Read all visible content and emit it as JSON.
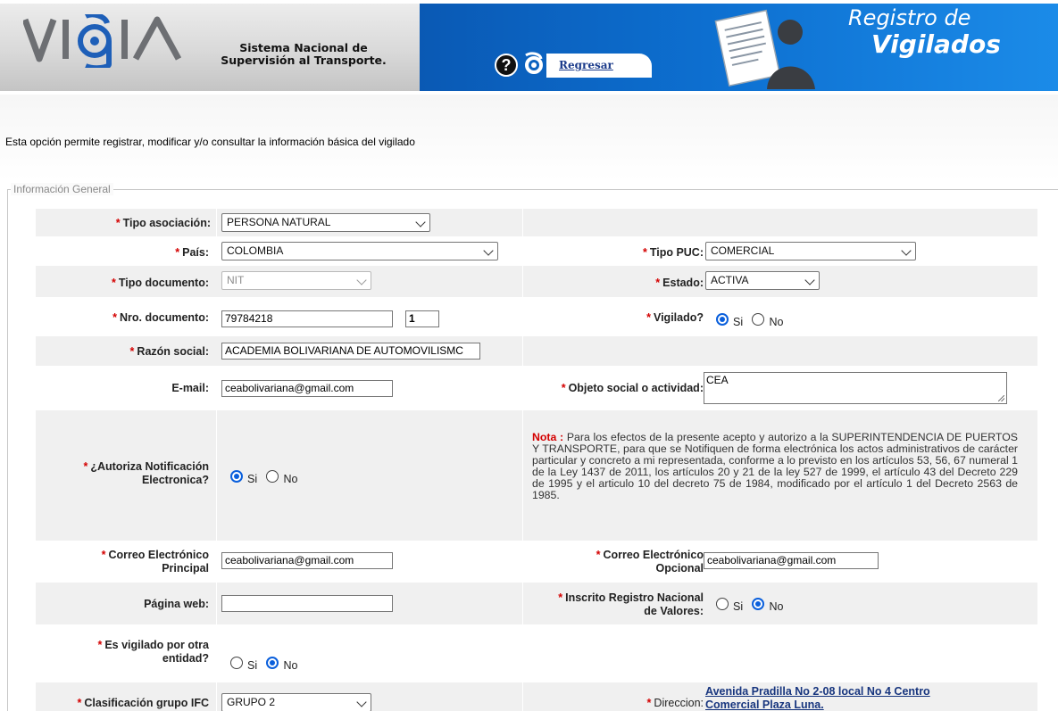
{
  "header": {
    "logo_text": "VIGIA",
    "system_title": "Sistema Nacional de Supervisión al Transporte.",
    "back_link": "Regresar",
    "module_title_line1": "Registro de",
    "module_title_line2": "Vigilados",
    "icons": [
      "help-icon",
      "vigia-mini-logo-icon",
      "document-user-icon"
    ]
  },
  "intro_text": "Esta opción permite registrar, modificar y/o consultar la información básica del vigilado",
  "section_title": "Información General",
  "colors": {
    "header_blue": "#0d6fd0",
    "required_red": "#d40000",
    "radio_selected": "#0a5fdc",
    "row_grey": "#f0f0f0",
    "link_navy": "#17357e"
  },
  "required_mark": "*",
  "form": {
    "tipo_asociacion": {
      "label": "Tipo asociación:",
      "value": "PERSONA NATURAL"
    },
    "pais": {
      "label": "País:",
      "value": "COLOMBIA"
    },
    "tipo_puc": {
      "label": "Tipo PUC:",
      "value": "COMERCIAL"
    },
    "tipo_documento": {
      "label": "Tipo documento:",
      "value": "NIT"
    },
    "estado": {
      "label": "Estado:",
      "value": "ACTIVA"
    },
    "nro_documento": {
      "label": "Nro. documento:",
      "value": "79784218",
      "dv": "1"
    },
    "vigilado": {
      "label": "Vigilado?",
      "yes": "Si",
      "no": "No",
      "selected": "Si"
    },
    "razon_social": {
      "label": "Razón social:",
      "value": "ACADEMIA BOLIVARIANA DE AUTOMOVILISMC"
    },
    "email": {
      "label": "E-mail:",
      "value": "ceabolivariana@gmail.com"
    },
    "objeto_social": {
      "label": "Objeto social o actividad:",
      "value": "CEA"
    },
    "autoriza_notificacion": {
      "label_line1": "¿Autoriza Notificación",
      "label_line2": "Electronica?",
      "yes": "Si",
      "no": "No",
      "selected": "Si"
    },
    "nota": {
      "label": "Nota :",
      "text": "Para los efectos de la presente acepto y autorizo a la SUPERINTENDENCIA DE PUERTOS Y TRANSPORTE, para que se Notifiquen de forma electrónica los actos administrativos de carácter particular y concreto a mi representada, conforme a lo previsto en los artículos 53, 56, 67 numeral 1 de la Ley 1437 de 2011, los artículos 20 y 21 de la ley 527 de 1999, el artículo 43 del Decreto 229 de 1995 y el articulo 10 del decreto 75 de 1984, modificado por el artículo 1 del Decreto 2563 de 1985."
    },
    "correo_principal": {
      "label_line1": "Correo Electrónico",
      "label_line2": "Principal",
      "value": "ceabolivariana@gmail.com"
    },
    "correo_opcional": {
      "label_line1": "Correo Electrónico",
      "label_line2": "Opcional",
      "value": "ceabolivariana@gmail.com"
    },
    "pagina_web": {
      "label": "Página web:",
      "value": ""
    },
    "registro_valores": {
      "label_line1": "Inscrito Registro Nacional",
      "label_line2": "de Valores:",
      "yes": "Si",
      "no": "No",
      "selected": "No"
    },
    "vigilado_otra": {
      "label_line1": "Es vigilado por otra",
      "label_line2": "entidad?",
      "yes": "Si",
      "no": "No",
      "selected": "No"
    },
    "clasificacion_ifc": {
      "label": "Clasificación grupo IFC",
      "value": "GRUPO 2"
    },
    "direccion": {
      "label": "Direccion:",
      "value_line1": "Avenida Pradilla No 2-08 local No 4 Centro",
      "value_line2": "Comercial Plaza Luna."
    }
  }
}
